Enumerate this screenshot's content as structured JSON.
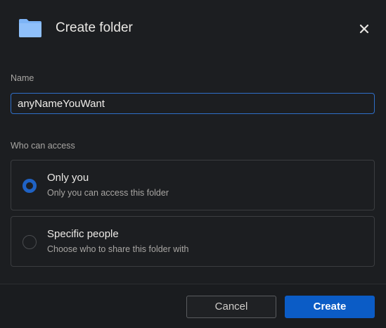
{
  "header": {
    "title": "Create folder",
    "icon": "folder-icon",
    "close_icon": "close-icon",
    "folder_color": "#7db4f6"
  },
  "name_field": {
    "label": "Name",
    "value": "anyNameYouWant"
  },
  "access": {
    "label": "Who can access",
    "options": [
      {
        "title": "Only you",
        "description": "Only you can access this folder",
        "selected": true
      },
      {
        "title": "Specific people",
        "description": "Choose who to share this folder with",
        "selected": false
      }
    ]
  },
  "footer": {
    "cancel_label": "Cancel",
    "create_label": "Create"
  },
  "colors": {
    "accent": "#0b5cc6",
    "background": "#1c1e21"
  }
}
